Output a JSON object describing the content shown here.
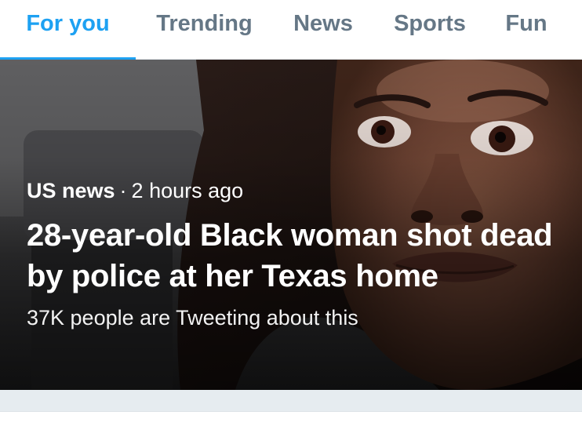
{
  "tabs": [
    {
      "label": "For you",
      "active": true
    },
    {
      "label": "Trending",
      "active": false
    },
    {
      "label": "News",
      "active": false
    },
    {
      "label": "Sports",
      "active": false
    },
    {
      "label": "Fun",
      "active": false
    }
  ],
  "story": {
    "category": "US news",
    "separator": "·",
    "time": "2 hours ago",
    "headline": "28-year-old Black woman shot dead by police at her Texas home",
    "engagement": "37K people are Tweeting about this",
    "image": "photo of a woman's face (close-up portrait)"
  },
  "colors": {
    "accent": "#1da1f2",
    "tab_inactive": "#657786",
    "divider": "#e6ecf0"
  }
}
